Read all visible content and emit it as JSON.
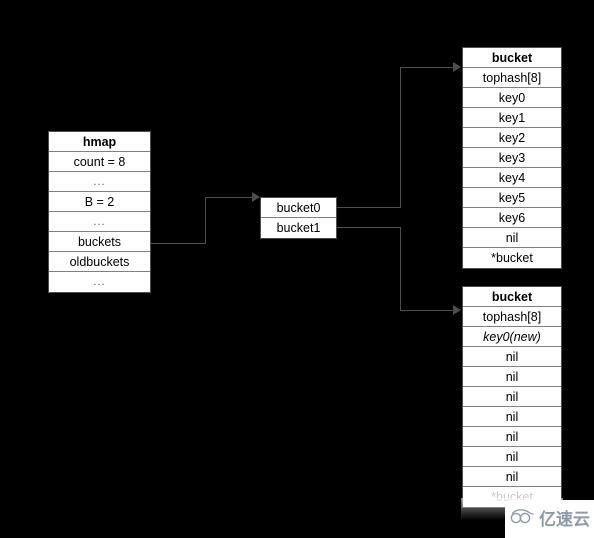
{
  "diagram": {
    "title": "Go hmap bucket structure",
    "background_color": "#000000",
    "box_fill_color": "#ffffff",
    "border_color": "#4d4d4d"
  },
  "hmap": {
    "header": "hmap",
    "rows": [
      "count = 8",
      "...",
      "B = 2",
      "...",
      "buckets",
      "oldbuckets",
      "..."
    ]
  },
  "bucket_pointers": {
    "rows": [
      "bucket0",
      "bucket1"
    ]
  },
  "bucket_top": {
    "header": "bucket",
    "rows": [
      "tophash[8]",
      "key0",
      "key1",
      "key2",
      "key3",
      "key4",
      "key5",
      "key6",
      "nil",
      "*bucket"
    ]
  },
  "bucket_bottom": {
    "header": "bucket",
    "rows": [
      "tophash[8]",
      "key0(new)",
      "nil",
      "nil",
      "nil",
      "nil",
      "nil",
      "nil",
      "nil",
      "*bucket"
    ]
  },
  "watermark": {
    "text": "亿速云",
    "logo": "cloud-icon",
    "color": "#8d9aa8"
  }
}
